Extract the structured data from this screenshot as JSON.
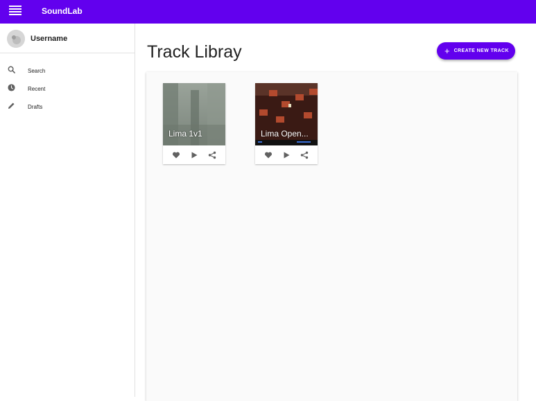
{
  "app": {
    "title": "SoundLab"
  },
  "user": {
    "name": "Username"
  },
  "sidebar": {
    "items": [
      {
        "label": "Search",
        "icon": "search-icon"
      },
      {
        "label": "Recent",
        "icon": "clock-icon"
      },
      {
        "label": "Drafts",
        "icon": "pencil-icon"
      }
    ]
  },
  "main": {
    "title": "Track Libray",
    "create_button": "CREATE NEW TRACK"
  },
  "tracks": [
    {
      "title": "Lima 1v1",
      "thumb": "misty-forest"
    },
    {
      "title": "Lima Open...",
      "thumb": "brick-level"
    }
  ],
  "colors": {
    "primary": "#6200ee",
    "panel": "#fafafa",
    "icon": "#616161"
  }
}
